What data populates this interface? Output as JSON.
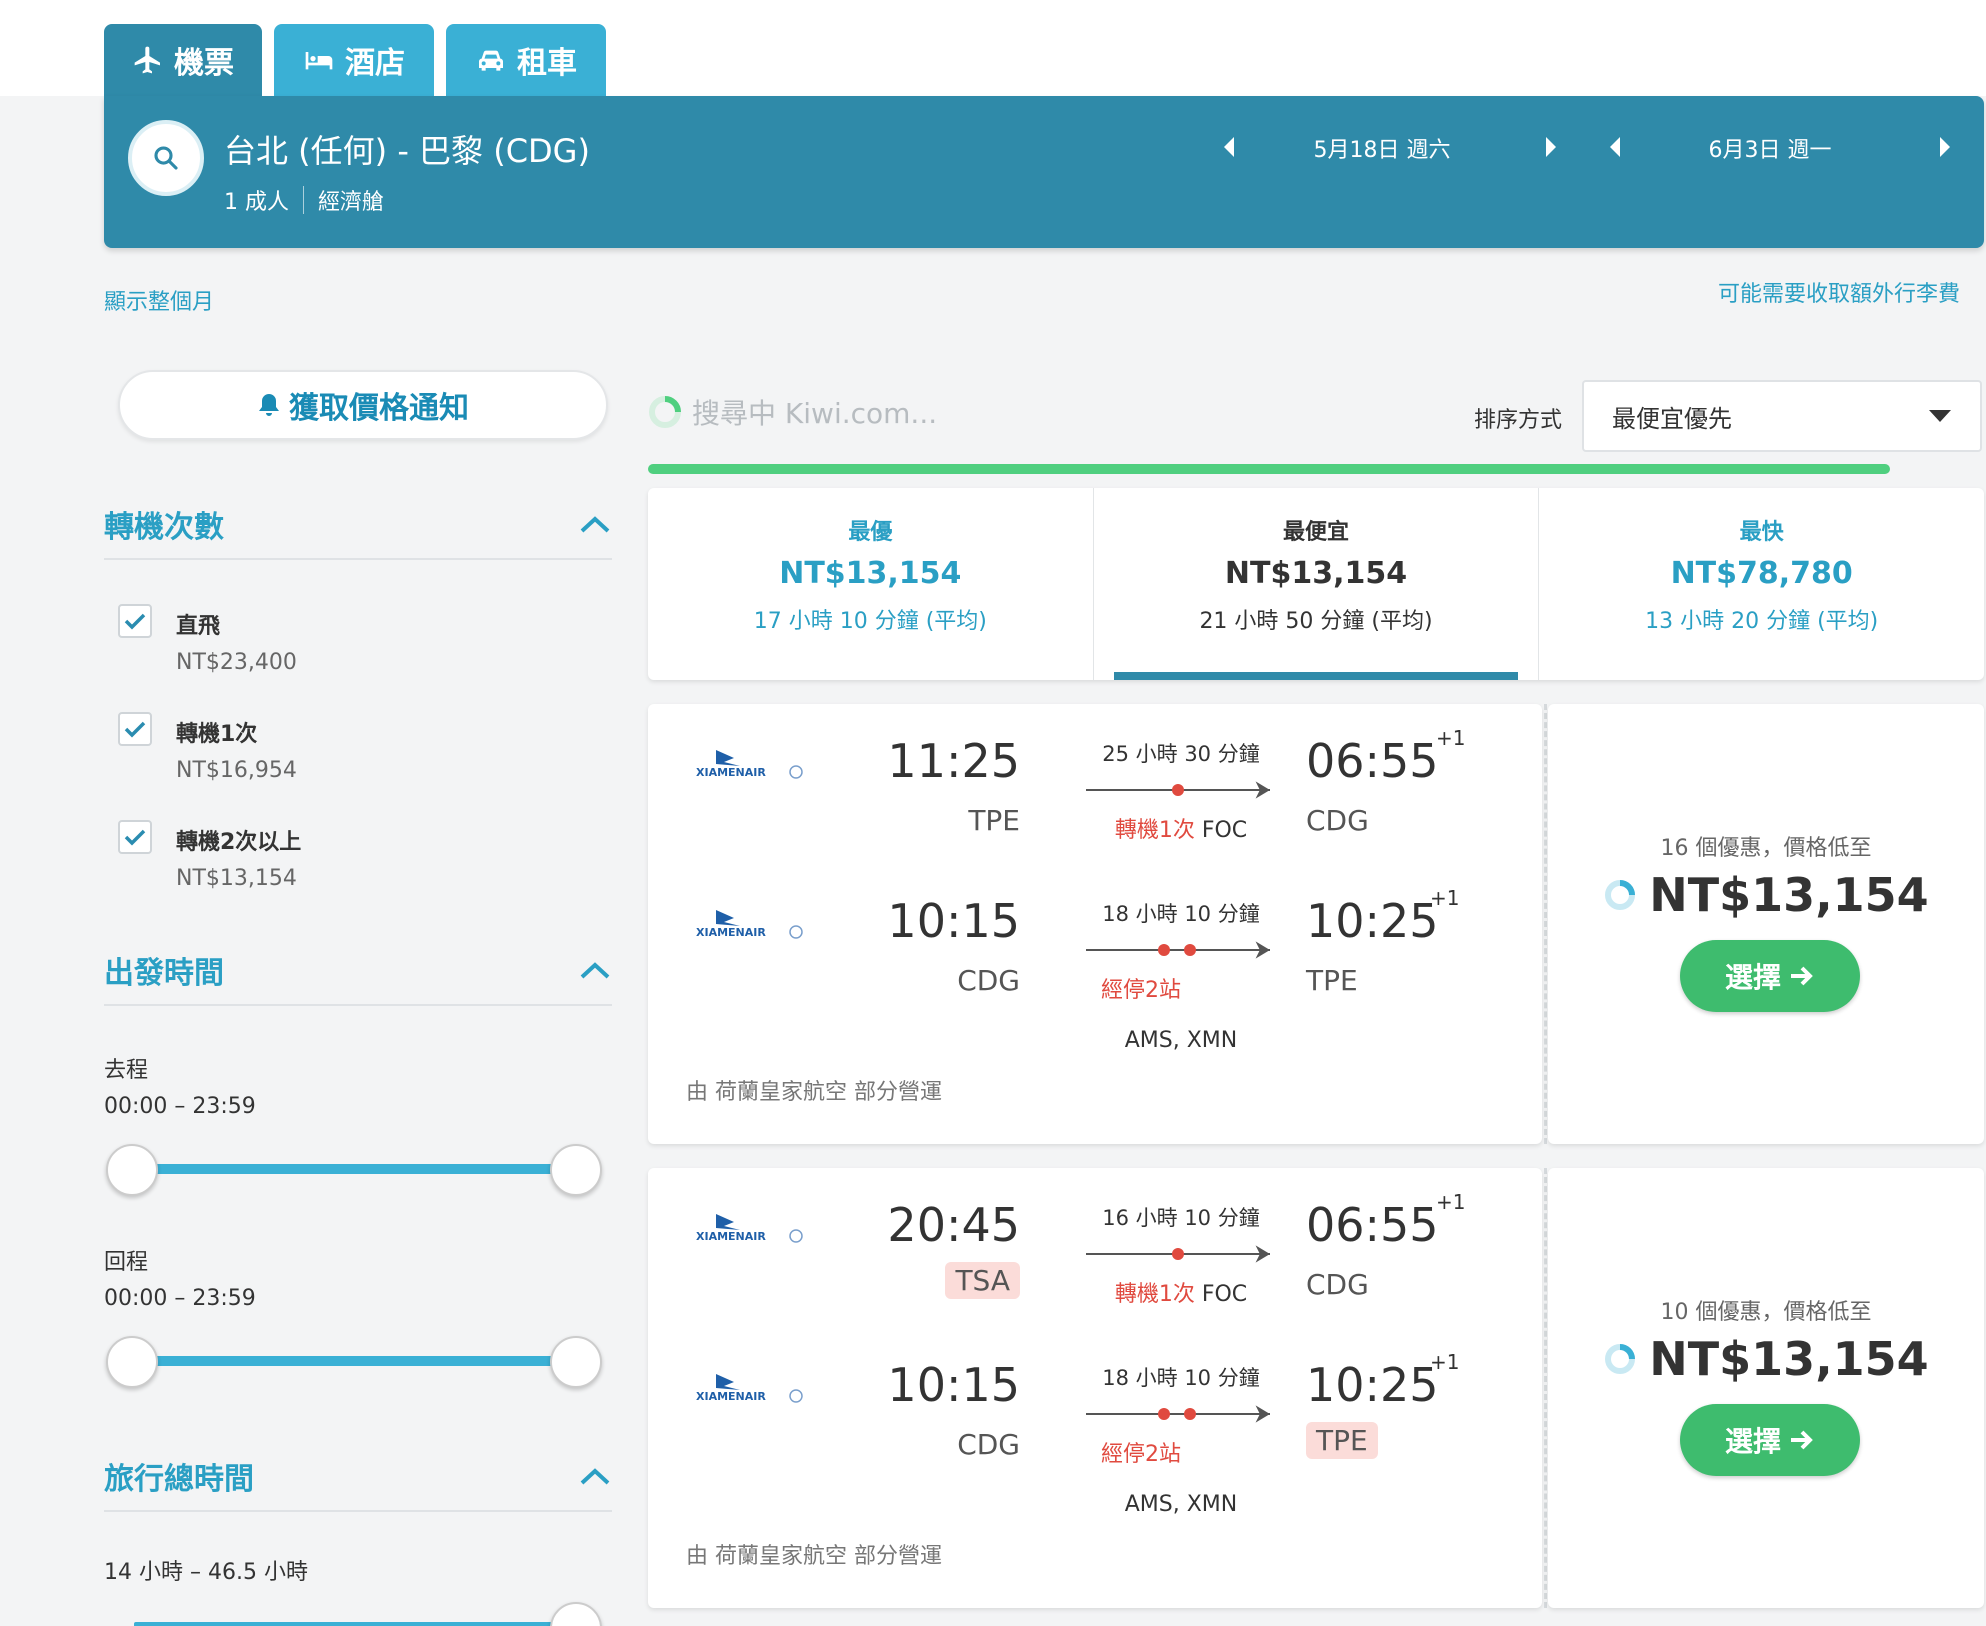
{
  "tabs": [
    {
      "label": "機票",
      "icon": "airplane-icon",
      "active": true
    },
    {
      "label": "酒店",
      "icon": "bed-icon",
      "active": false
    },
    {
      "label": "租車",
      "icon": "car-icon",
      "active": false
    }
  ],
  "search": {
    "route": "台北 (任何) - 巴黎 (CDG)",
    "passengers": "1 成人",
    "cabin": "經濟艙",
    "depart_date": "5月18日 週六",
    "return_date": "6月3日 週一"
  },
  "links": {
    "show_month": "顯示整個月",
    "baggage_fee": "可能需要收取額外行李費"
  },
  "notify_label": "獲取價格通知",
  "filters": {
    "stops": {
      "title": "轉機次數",
      "options": [
        {
          "label": "直飛",
          "price": "NT$23,400",
          "checked": true
        },
        {
          "label": "轉機1次",
          "price": "NT$16,954",
          "checked": true
        },
        {
          "label": "轉機2次以上",
          "price": "NT$13,154",
          "checked": true
        }
      ]
    },
    "departure_time": {
      "title": "出發時間",
      "outbound_label": "去程",
      "outbound_range": "00:00 – 23:59",
      "return_label": "回程",
      "return_range": "00:00 – 23:59"
    },
    "total_duration": {
      "title": "旅行總時間",
      "range": "14 小時 – 46.5 小時"
    }
  },
  "loading_text": "搜尋中 Kiwi.com...",
  "sort": {
    "label": "排序方式",
    "selected": "最便宜優先"
  },
  "summary": [
    {
      "title": "最優",
      "price": "NT$13,154",
      "duration": "17 小時 10 分鐘 (平均)"
    },
    {
      "title": "最便宜",
      "price": "NT$13,154",
      "duration": "21 小時 50 分鐘 (平均)"
    },
    {
      "title": "最快",
      "price": "NT$78,780",
      "duration": "13 小時 20 分鐘 (平均)"
    }
  ],
  "results": [
    {
      "legs": [
        {
          "airline": "XIAMENAIR",
          "dep_time": "11:25",
          "dep_code": "TPE",
          "duration": "25 小時 30 分鐘",
          "stops_red": "轉機1次",
          "stops_extra": "FOC",
          "via": "",
          "arr_time": "06:55",
          "arr_plus": "+1",
          "arr_code": "CDG"
        },
        {
          "airline": "XIAMENAIR",
          "dep_time": "10:15",
          "dep_code": "CDG",
          "duration": "18 小時 10 分鐘",
          "stops_red": "經停2站",
          "stops_extra": "",
          "via": "AMS, XMN",
          "arr_time": "10:25",
          "arr_plus": "+1",
          "arr_code": "TPE"
        }
      ],
      "operator": "由 荷蘭皇家航空 部分營運",
      "deals": "16 個優惠，價格低至",
      "price": "NT$13,154",
      "select_label": "選擇"
    },
    {
      "legs": [
        {
          "airline": "XIAMENAIR",
          "dep_time": "20:45",
          "dep_code": "TSA",
          "duration": "16 小時 10 分鐘",
          "stops_red": "轉機1次",
          "stops_extra": "FOC",
          "via": "",
          "arr_time": "06:55",
          "arr_plus": "+1",
          "arr_code": "CDG"
        },
        {
          "airline": "XIAMENAIR",
          "dep_time": "10:15",
          "dep_code": "CDG",
          "duration": "18 小時 10 分鐘",
          "stops_red": "經停2站",
          "stops_extra": "",
          "via": "AMS, XMN",
          "arr_time": "10:25",
          "arr_plus": "+1",
          "arr_code": "TPE"
        }
      ],
      "operator": "由 荷蘭皇家航空 部分營運",
      "deals": "10 個優惠，價格低至",
      "price": "NT$13,154",
      "select_label": "選擇"
    }
  ]
}
